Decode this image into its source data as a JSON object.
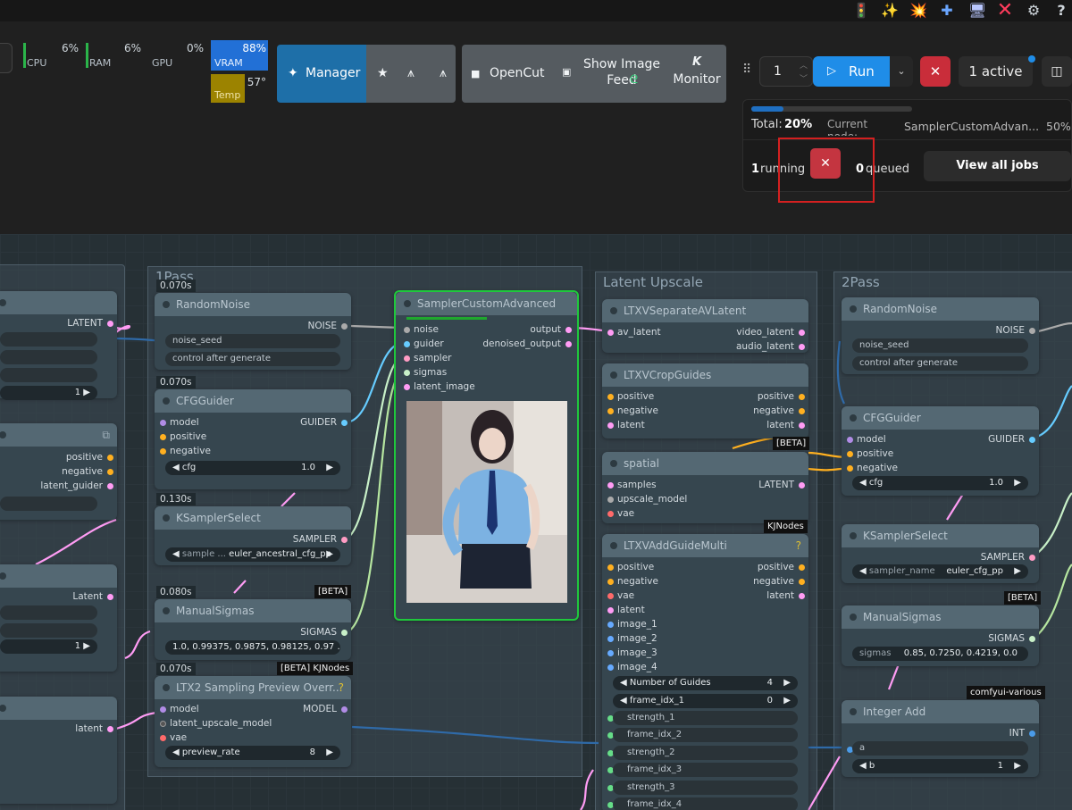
{
  "toolbar_icons": [
    "traffic-light-icon",
    "sparkles-icon",
    "firework-icon",
    "bandage-icon",
    "computer-icon",
    "red-x-icon",
    "gear-icon",
    "help-icon"
  ],
  "stats": {
    "cpu_label": "CPU",
    "cpu_value": "6%",
    "ram_label": "RAM",
    "ram_value": "6%",
    "gpu_label": "GPU",
    "gpu_value": "0%",
    "vram_label": "VRAM",
    "vram_value": "88%",
    "temp_label": "Temp",
    "temp_value": "57°"
  },
  "header": {
    "manager_label": "Manager",
    "opencut_label": "OpenCut",
    "show_image_feed_label": "Show Image\nFeed",
    "monitor_label": "Monitor",
    "queue_count": "1",
    "run_label": "Run",
    "active_label": "1 active"
  },
  "progress": {
    "total_label": "Total:",
    "total_value": "20%",
    "current_label": "Current\nnode:",
    "current_node": "SamplerCustomAdvan...",
    "current_value": "50%",
    "total_fraction": 0.2,
    "node_fraction": 0.5
  },
  "jobs": {
    "running_count": "1",
    "running_label": "running",
    "queued_count": "0",
    "queued_label": "queued",
    "view_all_label": "View all jobs"
  },
  "groups": {
    "pass1": "1Pass",
    "latent_upscale": "Latent Upscale",
    "pass2": "2Pass"
  },
  "nodes": {
    "left_latent": "LATENT",
    "left_value1": "1",
    "left_pos": "positive",
    "left_neg": "negative",
    "left_guider": "latent_guider",
    "left_latent2": "Latent",
    "left_value2": "1",
    "left_latent3": "latent",
    "random_noise": {
      "title": "RandomNoise",
      "timing": "0.070s",
      "out": "NOISE",
      "noise_seed": "noise_seed",
      "control": "control after generate"
    },
    "cfg_guider": {
      "title": "CFGGuider",
      "timing": "0.070s",
      "model": "model",
      "positive": "positive",
      "negative": "negative",
      "out": "GUIDER",
      "cfg_label": "cfg",
      "cfg_value": "1.0"
    },
    "ksampler": {
      "title": "KSamplerSelect",
      "timing": "0.130s",
      "out": "SAMPLER",
      "name_label": "sample ...",
      "name_value": "euler_ancestral_cfg_pp"
    },
    "manual_sigmas": {
      "title": "ManualSigmas",
      "timing": "0.080s",
      "tag": "[BETA]",
      "out": "SIGMAS",
      "value": "1.0, 0.99375, 0.9875, 0.98125, 0.97 ..."
    },
    "ltx2_preview": {
      "title": "LTX2 Sampling Preview Overr...",
      "timing": "0.070s",
      "tag": "[BETA] KJNodes",
      "model": "model",
      "latent_upscale_model": "latent_upscale_model",
      "vae": "vae",
      "out": "MODEL",
      "rate_label": "preview_rate",
      "rate_value": "8"
    },
    "sampler_custom": {
      "title": "SamplerCustomAdvanced",
      "noise": "noise",
      "guider": "guider",
      "sampler": "sampler",
      "sigmas": "sigmas",
      "latent_image": "latent_image",
      "output": "output",
      "denoised": "denoised_output",
      "progress_fraction": 0.5
    },
    "separate_av": {
      "title": "LTXVSeparateAVLatent",
      "av_latent": "av_latent",
      "video_latent": "video_latent",
      "audio_latent": "audio_latent"
    },
    "crop_guides": {
      "title": "LTXVCropGuides",
      "positive": "positive",
      "negative": "negative",
      "latent": "latent",
      "out_pos": "positive",
      "out_neg": "negative",
      "out_latent": "latent",
      "tag": "[BETA]"
    },
    "spatial": {
      "title": "spatial",
      "samples": "samples",
      "upscale_model": "upscale_model",
      "vae": "vae",
      "out": "LATENT",
      "tag": "KJNodes"
    },
    "add_guide": {
      "title": "LTXVAddGuideMulti",
      "positive": "positive",
      "negative": "negative",
      "vae": "vae",
      "latent": "latent",
      "image_1": "image_1",
      "image_2": "image_2",
      "image_3": "image_3",
      "image_4": "image_4",
      "out_pos": "positive",
      "out_neg": "negative",
      "out_latent": "latent",
      "num_label": "Number of Guides",
      "num_value": "4",
      "frame_idx_1_label": "frame_idx_1",
      "frame_idx_1_value": "0",
      "strength_1": "strength_1",
      "frame_idx_2": "frame_idx_2",
      "strength_2": "strength_2",
      "frame_idx_3": "frame_idx_3",
      "strength_3": "strength_3",
      "frame_idx_4": "frame_idx_4"
    },
    "random_noise2": {
      "title": "RandomNoise",
      "out": "NOISE",
      "noise_seed": "noise_seed",
      "control": "control after generate"
    },
    "cfg_guider2": {
      "title": "CFGGuider",
      "model": "model",
      "positive": "positive",
      "negative": "negative",
      "out": "GUIDER",
      "cfg_label": "cfg",
      "cfg_value": "1.0"
    },
    "ksampler2": {
      "title": "KSamplerSelect",
      "out": "SAMPLER",
      "name_label": "sampler_name",
      "name_value": "euler_cfg_pp",
      "tag": "[BETA]"
    },
    "manual_sigmas2": {
      "title": "ManualSigmas",
      "out": "SIGMAS",
      "label": "sigmas",
      "value": "0.85, 0.7250, 0.4219, 0.0",
      "tag": "comfyui-various"
    },
    "integer_add": {
      "title": "Integer Add",
      "out": "INT",
      "a_label": "a",
      "b_label": "b",
      "b_value": "1"
    }
  }
}
